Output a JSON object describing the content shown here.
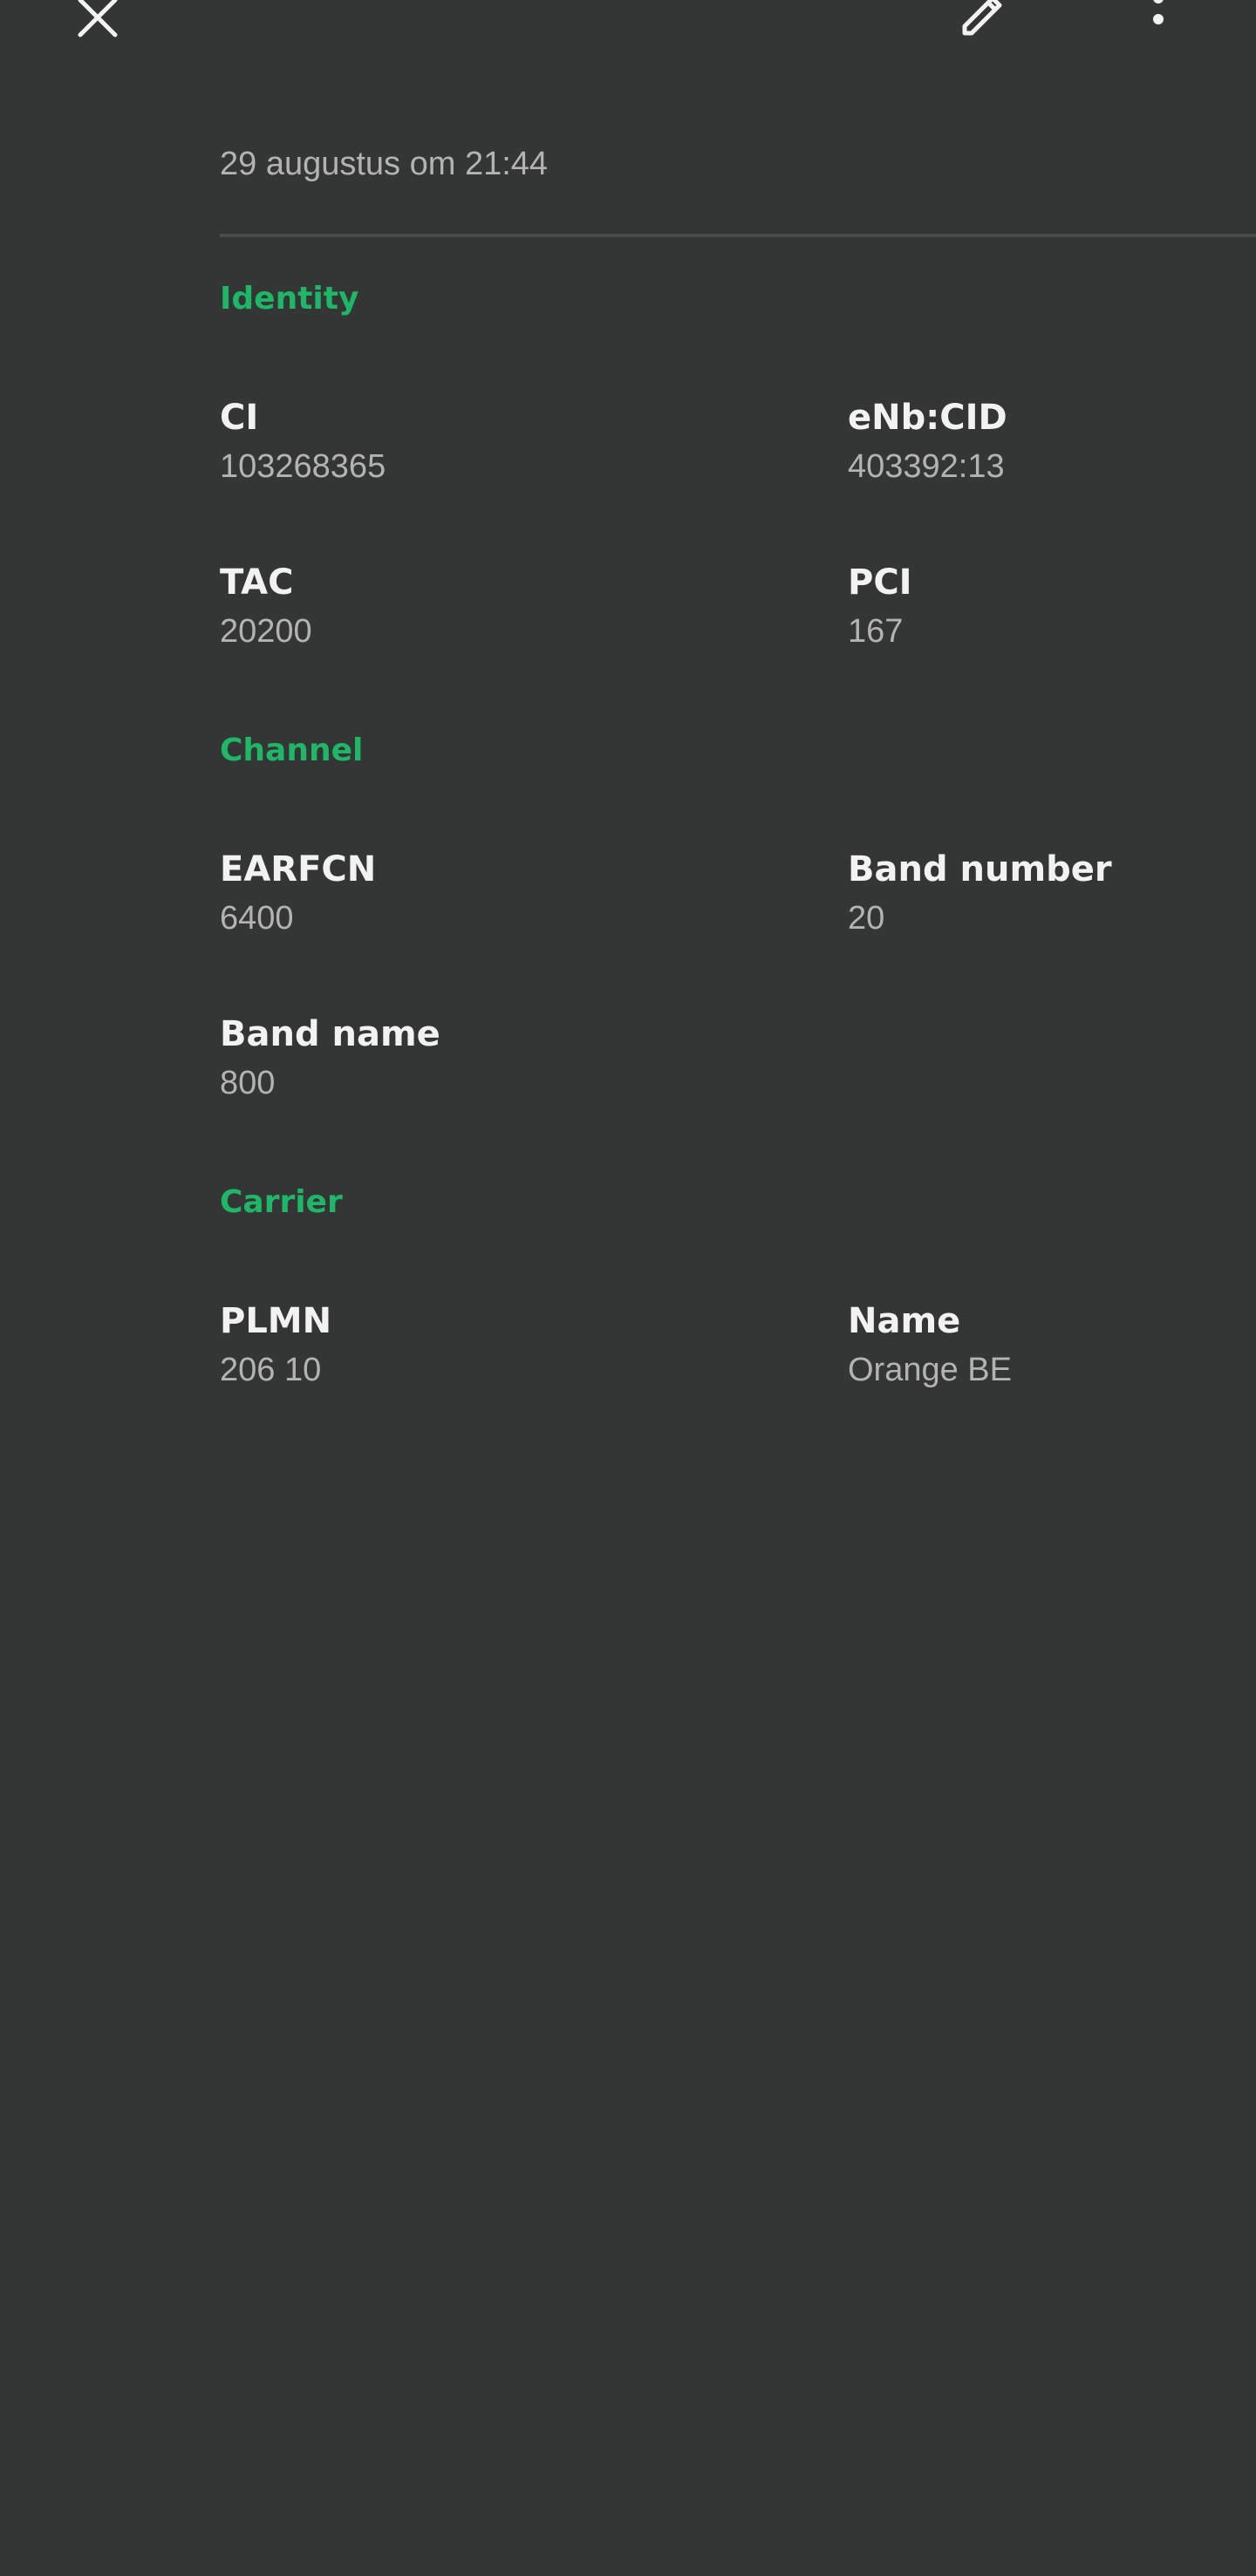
{
  "toolbar": {
    "close_icon": "close-icon",
    "edit_icon": "pencil-icon",
    "more_icon": "more-vertical-icon"
  },
  "timestamp": "29 augustus om 21:44",
  "colors": {
    "background": "#343535",
    "accent": "#1fb767",
    "label": "#f2f2f2",
    "value": "#b3b3b3"
  },
  "sections": {
    "identity": {
      "title": "Identity",
      "ci": {
        "label": "CI",
        "value": "103268365"
      },
      "enb_cid": {
        "label": "eNb:CID",
        "value": "403392:13"
      },
      "tac": {
        "label": "TAC",
        "value": "20200"
      },
      "pci": {
        "label": "PCI",
        "value": "167"
      }
    },
    "channel": {
      "title": "Channel",
      "earfcn": {
        "label": "EARFCN",
        "value": "6400"
      },
      "band_number": {
        "label": "Band number",
        "value": "20"
      },
      "band_name": {
        "label": "Band name",
        "value": "800"
      }
    },
    "carrier": {
      "title": "Carrier",
      "plmn": {
        "label": "PLMN",
        "value": "206 10"
      },
      "name": {
        "label": "Name",
        "value": "Orange BE"
      }
    }
  }
}
